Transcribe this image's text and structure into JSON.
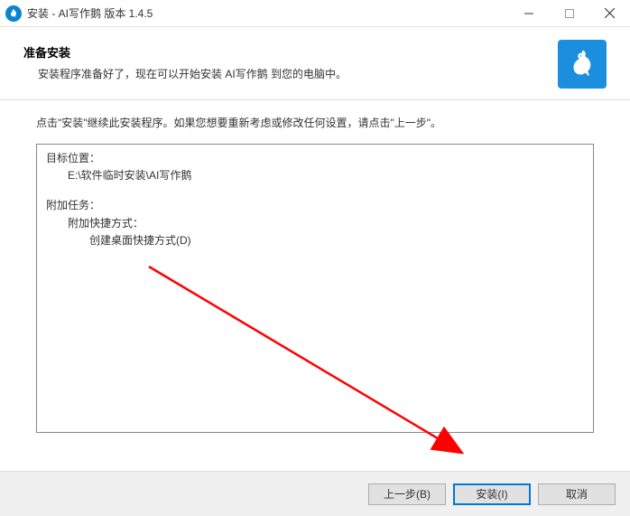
{
  "titlebar": {
    "title": "安装 - AI写作鹅 版本 1.4.5"
  },
  "header": {
    "heading": "准备安装",
    "subheading": "安装程序准备好了，现在可以开始安装 AI写作鹅 到您的电脑中。"
  },
  "instruction": "点击\"安装\"继续此安装程序。如果您想要重新考虑或修改任何设置，请点击\"上一步\"。",
  "summary": {
    "dest_label": "目标位置：",
    "dest_path": "E:\\软件临时安装\\AI写作鹅",
    "tasks_label": "附加任务：",
    "shortcuts_label": "附加快捷方式：",
    "desktop_shortcut": "创建桌面快捷方式(D)"
  },
  "buttons": {
    "back": "上一步(B)",
    "install": "安装(I)",
    "cancel": "取消"
  }
}
